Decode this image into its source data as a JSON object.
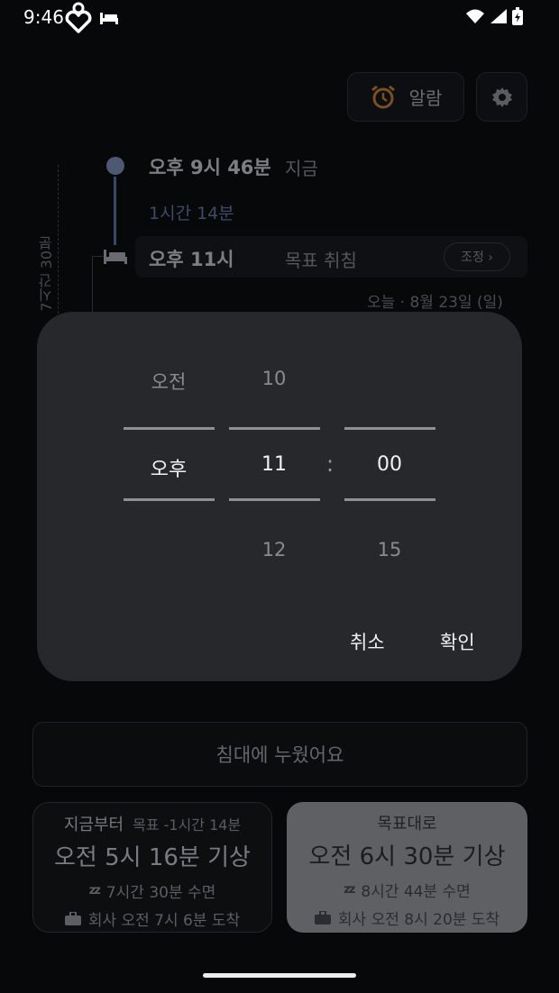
{
  "status_bar": {
    "time": "9:46"
  },
  "header": {
    "alarm_label": "알람"
  },
  "timeline": {
    "now_time": "오후 9시 46분",
    "now_label": "지금",
    "duration": "1시간 14분",
    "bedtime": "오후 11시",
    "bedtime_label": "목표 취침",
    "adjust": "조정 ›",
    "date": "오늘 · 8월 23일 (일)",
    "sleep_span": "7시간 30분"
  },
  "time_picker": {
    "ampm_above": "오전",
    "ampm_selected": "오후",
    "hour_above": "10",
    "hour_selected": "11",
    "hour_below": "12",
    "separator": ":",
    "minute_selected": "00",
    "minute_below": "15",
    "cancel": "취소",
    "confirm": "확인"
  },
  "in_bed_button": "침대에 누웠어요",
  "card_now": {
    "title": "지금부터",
    "subtitle": "목표 -1시간 14분",
    "wake": "오전 5시 16분 기상",
    "sleep": "7시간 30분 수면",
    "commute": "회사 오전 7시 6분 도착"
  },
  "card_target": {
    "title": "목표대로",
    "wake": "오전 6시 30분 기상",
    "sleep": "8시간 44분 수면",
    "commute": "회사 오전 8시 20분 도착"
  },
  "colors": {
    "background": "#07080a",
    "dialog": "#27282c",
    "accent_orange": "#8a5a2a",
    "timeline_blue": "#4d5872"
  }
}
